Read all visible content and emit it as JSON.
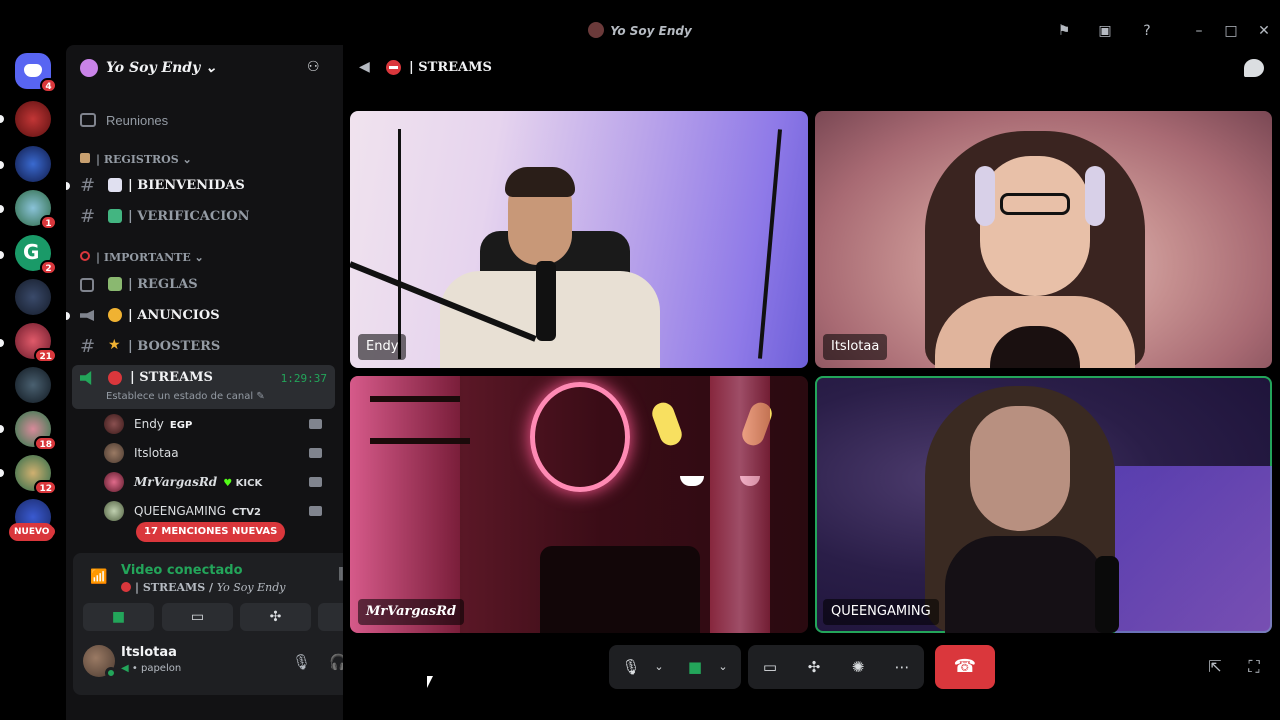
{
  "window": {
    "title": "Yo Soy Endy"
  },
  "rail": {
    "badges": [
      "4",
      "1",
      "2",
      "21",
      "18",
      "12",
      "4"
    ],
    "nuevo_label": "NUEVO"
  },
  "guild": {
    "name": "Yo Soy Endy"
  },
  "channels": {
    "reuniones": "Reuniones",
    "registros_category": "| REGISTROS",
    "bienvenidas": "| BIENVENIDAS",
    "verificacion": "| VERIFICACION",
    "importante_category": "| IMPORTANTE",
    "reglas": "| REGLAS",
    "anuncios": "| ANUNCIOS",
    "boosters": "| BOOSTERS",
    "streams": "| STREAMS",
    "streams_timer": "1:29:37",
    "streams_status": "Establece un estado de canal"
  },
  "voice_users": [
    {
      "name": "Endy",
      "tag": "EGP"
    },
    {
      "name": "Itslotaa",
      "tag": ""
    },
    {
      "name": "MrVargasRd",
      "tag": "KICK"
    },
    {
      "name": "QUEENGAMING",
      "tag": "CTV2"
    }
  ],
  "mentions_label": "17 MENCIONES NUEVAS",
  "voice_panel": {
    "title": "Video conectado",
    "channel": "| STREAMS / ",
    "guild": "Yo Soy Endy"
  },
  "user_panel": {
    "name": "Itslotaa",
    "status": "• papelon"
  },
  "stage": {
    "title": "| STREAMS",
    "tiles": [
      {
        "name": "Endy"
      },
      {
        "name": "Itslotaa"
      },
      {
        "name": "MrVargasRd"
      },
      {
        "name": "QUEENGAMING"
      }
    ]
  },
  "colors": {
    "accent_green": "#23a55a",
    "danger_red": "#da373c",
    "panel": "#1e1f22",
    "sidebar": "#121214"
  }
}
